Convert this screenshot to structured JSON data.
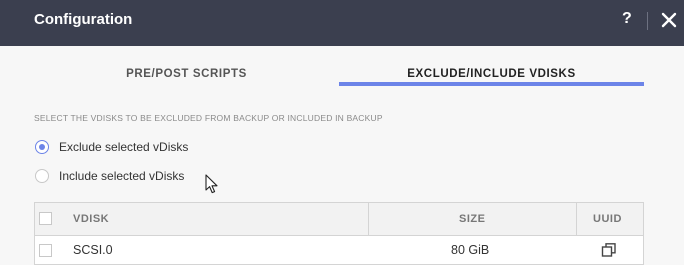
{
  "window": {
    "title": "Configuration",
    "help_label": "?"
  },
  "tabs": [
    {
      "label": "PRE/POST SCRIPTS",
      "active": false
    },
    {
      "label": "EXCLUDE/INCLUDE VDISKS",
      "active": true
    }
  ],
  "instruction": "SELECT THE VDISKS TO BE EXCLUDED FROM BACKUP OR INCLUDED IN BACKUP",
  "options": [
    {
      "label": "Exclude selected vDisks",
      "selected": true
    },
    {
      "label": "Include selected vDisks",
      "selected": false
    }
  ],
  "table": {
    "columns": [
      "VDISK",
      "SIZE",
      "UUID"
    ],
    "rows": [
      {
        "vdisk": "SCSI.0",
        "size": "80 GiB",
        "checked": false
      }
    ]
  },
  "colors": {
    "titlebar": "#3b3f4f",
    "accent": "#6c84e8",
    "background": "#f7f7f7"
  },
  "icons": [
    "help-icon",
    "close-icon",
    "copy-icon",
    "mouse-pointer-icon"
  ]
}
